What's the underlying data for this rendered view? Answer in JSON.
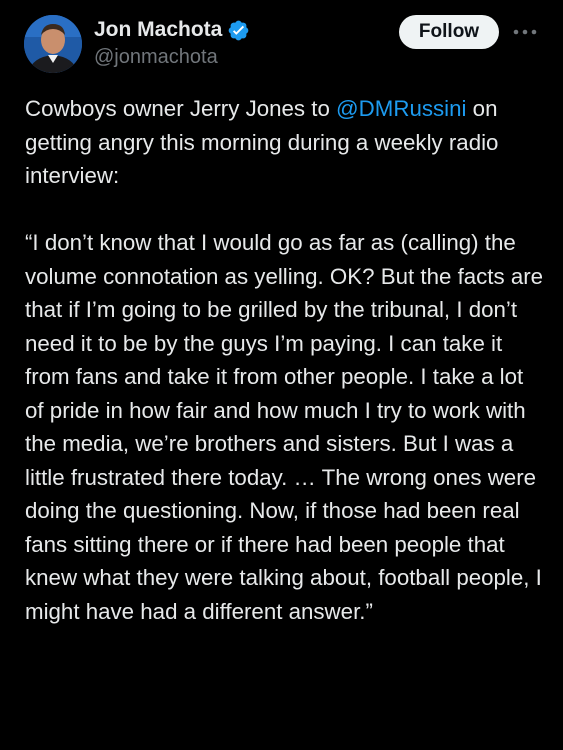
{
  "author": {
    "display_name": "Jon Machota",
    "handle": "@jonmachota",
    "verified": true,
    "avatar_icon": "profile-photo"
  },
  "actions": {
    "follow_label": "Follow",
    "more_icon": "more-horizontal-icon"
  },
  "tweet": {
    "intro_before_mention": "Cowboys owner Jerry Jones to ",
    "mention": "@DMRussini",
    "intro_after_mention": " on getting angry this morning during a weekly radio interview:",
    "quote": "“I don’t know that I would go as far as (calling) the volume connotation as yelling. OK? But the facts are that if I’m going to be grilled by the tribunal, I don’t need it to be by the guys I’m paying. I can take it from fans and take it from other people. I take a lot of pride in how fair and how much I try to work with the media, we’re brothers and sisters. But I was a little frustrated there today. … The wrong ones were doing the questioning. Now, if those had been real fans sitting there or if there had been people that knew what they were talking about, football people, I might have had a different answer.”"
  },
  "colors": {
    "background": "#000000",
    "text": "#e7e9ea",
    "secondary_text": "#71767b",
    "link": "#1d9bf0",
    "verified_badge": "#1d9bf0",
    "follow_button_bg": "#eff3f4",
    "follow_button_text": "#0f1419"
  }
}
